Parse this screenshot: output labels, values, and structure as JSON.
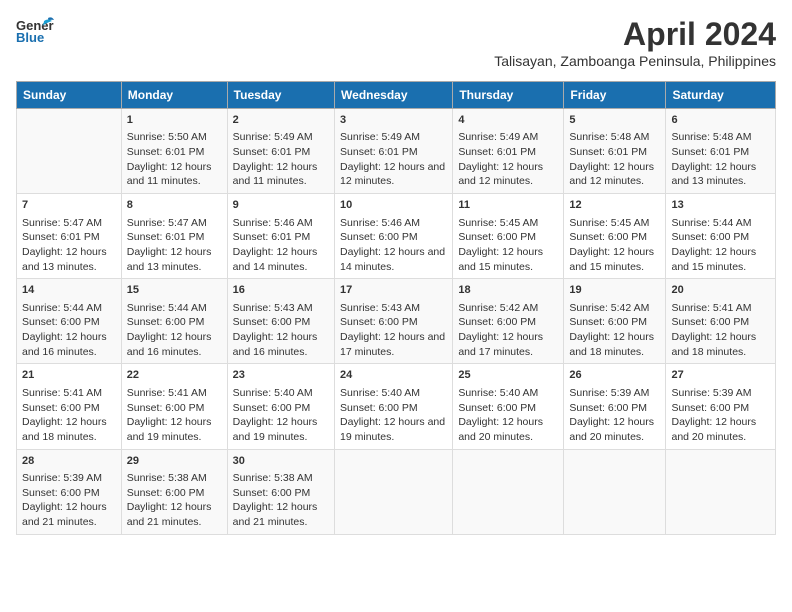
{
  "header": {
    "logo_general": "General",
    "logo_blue": "Blue",
    "title": "April 2024",
    "subtitle": "Talisayan, Zamboanga Peninsula, Philippines"
  },
  "days_of_week": [
    "Sunday",
    "Monday",
    "Tuesday",
    "Wednesday",
    "Thursday",
    "Friday",
    "Saturday"
  ],
  "weeks": [
    [
      {
        "day": "",
        "info": ""
      },
      {
        "day": "1",
        "info": "Sunrise: 5:50 AM\nSunset: 6:01 PM\nDaylight: 12 hours and 11 minutes."
      },
      {
        "day": "2",
        "info": "Sunrise: 5:49 AM\nSunset: 6:01 PM\nDaylight: 12 hours and 11 minutes."
      },
      {
        "day": "3",
        "info": "Sunrise: 5:49 AM\nSunset: 6:01 PM\nDaylight: 12 hours and 12 minutes."
      },
      {
        "day": "4",
        "info": "Sunrise: 5:49 AM\nSunset: 6:01 PM\nDaylight: 12 hours and 12 minutes."
      },
      {
        "day": "5",
        "info": "Sunrise: 5:48 AM\nSunset: 6:01 PM\nDaylight: 12 hours and 12 minutes."
      },
      {
        "day": "6",
        "info": "Sunrise: 5:48 AM\nSunset: 6:01 PM\nDaylight: 12 hours and 13 minutes."
      }
    ],
    [
      {
        "day": "7",
        "info": "Sunrise: 5:47 AM\nSunset: 6:01 PM\nDaylight: 12 hours and 13 minutes."
      },
      {
        "day": "8",
        "info": "Sunrise: 5:47 AM\nSunset: 6:01 PM\nDaylight: 12 hours and 13 minutes."
      },
      {
        "day": "9",
        "info": "Sunrise: 5:46 AM\nSunset: 6:01 PM\nDaylight: 12 hours and 14 minutes."
      },
      {
        "day": "10",
        "info": "Sunrise: 5:46 AM\nSunset: 6:00 PM\nDaylight: 12 hours and 14 minutes."
      },
      {
        "day": "11",
        "info": "Sunrise: 5:45 AM\nSunset: 6:00 PM\nDaylight: 12 hours and 15 minutes."
      },
      {
        "day": "12",
        "info": "Sunrise: 5:45 AM\nSunset: 6:00 PM\nDaylight: 12 hours and 15 minutes."
      },
      {
        "day": "13",
        "info": "Sunrise: 5:44 AM\nSunset: 6:00 PM\nDaylight: 12 hours and 15 minutes."
      }
    ],
    [
      {
        "day": "14",
        "info": "Sunrise: 5:44 AM\nSunset: 6:00 PM\nDaylight: 12 hours and 16 minutes."
      },
      {
        "day": "15",
        "info": "Sunrise: 5:44 AM\nSunset: 6:00 PM\nDaylight: 12 hours and 16 minutes."
      },
      {
        "day": "16",
        "info": "Sunrise: 5:43 AM\nSunset: 6:00 PM\nDaylight: 12 hours and 16 minutes."
      },
      {
        "day": "17",
        "info": "Sunrise: 5:43 AM\nSunset: 6:00 PM\nDaylight: 12 hours and 17 minutes."
      },
      {
        "day": "18",
        "info": "Sunrise: 5:42 AM\nSunset: 6:00 PM\nDaylight: 12 hours and 17 minutes."
      },
      {
        "day": "19",
        "info": "Sunrise: 5:42 AM\nSunset: 6:00 PM\nDaylight: 12 hours and 18 minutes."
      },
      {
        "day": "20",
        "info": "Sunrise: 5:41 AM\nSunset: 6:00 PM\nDaylight: 12 hours and 18 minutes."
      }
    ],
    [
      {
        "day": "21",
        "info": "Sunrise: 5:41 AM\nSunset: 6:00 PM\nDaylight: 12 hours and 18 minutes."
      },
      {
        "day": "22",
        "info": "Sunrise: 5:41 AM\nSunset: 6:00 PM\nDaylight: 12 hours and 19 minutes."
      },
      {
        "day": "23",
        "info": "Sunrise: 5:40 AM\nSunset: 6:00 PM\nDaylight: 12 hours and 19 minutes."
      },
      {
        "day": "24",
        "info": "Sunrise: 5:40 AM\nSunset: 6:00 PM\nDaylight: 12 hours and 19 minutes."
      },
      {
        "day": "25",
        "info": "Sunrise: 5:40 AM\nSunset: 6:00 PM\nDaylight: 12 hours and 20 minutes."
      },
      {
        "day": "26",
        "info": "Sunrise: 5:39 AM\nSunset: 6:00 PM\nDaylight: 12 hours and 20 minutes."
      },
      {
        "day": "27",
        "info": "Sunrise: 5:39 AM\nSunset: 6:00 PM\nDaylight: 12 hours and 20 minutes."
      }
    ],
    [
      {
        "day": "28",
        "info": "Sunrise: 5:39 AM\nSunset: 6:00 PM\nDaylight: 12 hours and 21 minutes."
      },
      {
        "day": "29",
        "info": "Sunrise: 5:38 AM\nSunset: 6:00 PM\nDaylight: 12 hours and 21 minutes."
      },
      {
        "day": "30",
        "info": "Sunrise: 5:38 AM\nSunset: 6:00 PM\nDaylight: 12 hours and 21 minutes."
      },
      {
        "day": "",
        "info": ""
      },
      {
        "day": "",
        "info": ""
      },
      {
        "day": "",
        "info": ""
      },
      {
        "day": "",
        "info": ""
      }
    ]
  ]
}
